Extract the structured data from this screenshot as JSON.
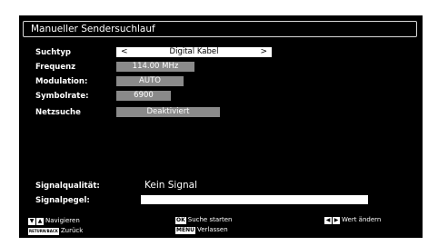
{
  "title": "Manueller Sendersuchlauf",
  "rows": [
    {
      "label": "Suchtyp",
      "value": "Digital Kabel",
      "selected": true
    },
    {
      "label": "Frequenz",
      "value": "114.00 MHz"
    },
    {
      "label": "Modulation:",
      "value": "AUTO"
    },
    {
      "label": "Symbolrate:",
      "value": "6900"
    },
    {
      "label": "Netzsuche",
      "value": "Deaktiviert"
    }
  ],
  "arrows": {
    "left": "<",
    "right": ">"
  },
  "signal": {
    "quality_label": "Signalqualität:",
    "quality_value": "Kein Signal",
    "level_label": "Signalpegel:",
    "level_fraction": 1.0
  },
  "footer": {
    "navigate_label": "Navigieren",
    "back_key": "RETURN/BACK",
    "back_label": "Zurück",
    "ok_key": "OK",
    "ok_label": "Suche starten",
    "menu_key": "MENU",
    "menu_label": "Verlassen",
    "value_label": "Wert ändern"
  },
  "colors": {
    "background": "#000000",
    "value_box": "#8a8a8a",
    "selected_box": "#ffffff"
  }
}
